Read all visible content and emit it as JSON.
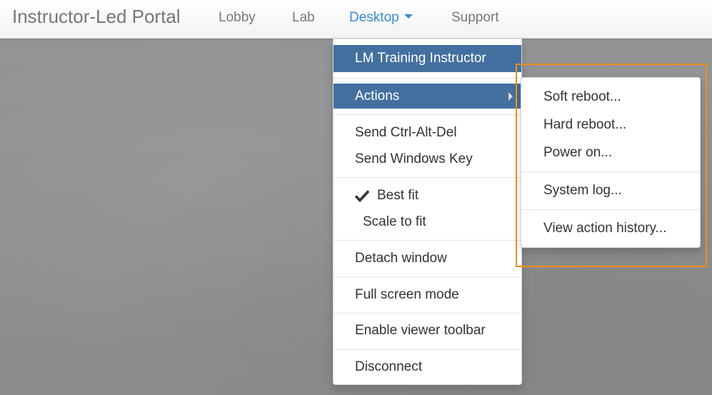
{
  "navbar": {
    "brand": "Instructor-Led Portal",
    "links": [
      {
        "label": "Lobby"
      },
      {
        "label": "Lab"
      },
      {
        "label": "Desktop"
      },
      {
        "label": "Support"
      }
    ],
    "active_color": "#3a8bd1"
  },
  "desktop_menu": {
    "header": "LM Training Instructor",
    "items": {
      "actions": "Actions",
      "send_ctrl_alt_del": "Send Ctrl-Alt-Del",
      "send_windows_key": "Send Windows Key",
      "best_fit": "Best fit",
      "scale_to_fit": "Scale to fit",
      "detach_window": "Detach window",
      "full_screen_mode": "Full screen mode",
      "enable_viewer_toolbar": "Enable viewer toolbar",
      "disconnect": "Disconnect"
    },
    "best_fit_checked": true,
    "highlight_color": "#43709f"
  },
  "actions_submenu": {
    "items": {
      "soft_reboot": "Soft reboot...",
      "hard_reboot": "Hard reboot...",
      "power_on": "Power on...",
      "system_log": "System log...",
      "view_action_history": "View action history..."
    }
  },
  "annotation": {
    "color": "#f28c1c"
  }
}
